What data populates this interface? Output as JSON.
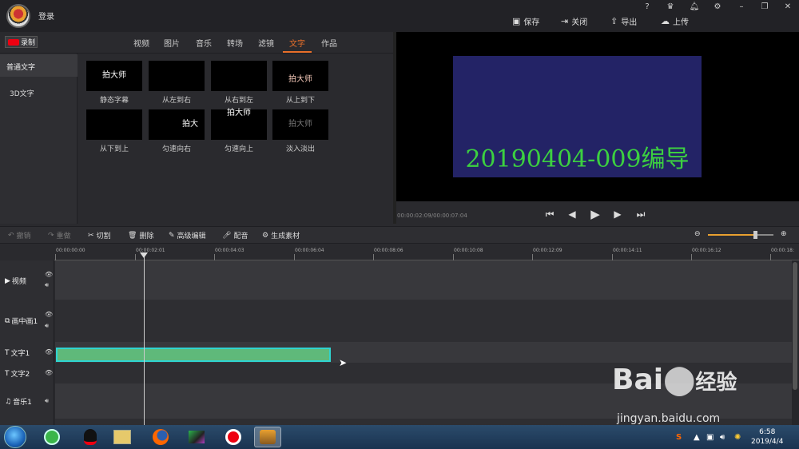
{
  "header": {
    "login": "登录",
    "actions": [
      {
        "label": "保存",
        "icon": "save-icon"
      },
      {
        "label": "关闭",
        "icon": "close-file-icon"
      },
      {
        "label": "导出",
        "icon": "export-icon"
      },
      {
        "label": "上传",
        "icon": "upload-icon"
      }
    ]
  },
  "record_label": "录制",
  "tabs": [
    "视频",
    "图片",
    "音乐",
    "转场",
    "滤镜",
    "文字",
    "作品"
  ],
  "active_tab": "文字",
  "categories": [
    "普通文字",
    "3D文字"
  ],
  "thumbnails": [
    {
      "label": "静态字幕",
      "preview": "拍大师"
    },
    {
      "label": "从左到右",
      "preview": ""
    },
    {
      "label": "从右到左",
      "preview": ""
    },
    {
      "label": "从上到下",
      "preview": "拍大师"
    },
    {
      "label": "从下到上",
      "preview": ""
    },
    {
      "label": "匀速向右",
      "preview": "拍大"
    },
    {
      "label": "匀速向上",
      "preview": "拍大师"
    },
    {
      "label": "淡入淡出",
      "preview": "拍大师"
    }
  ],
  "preview": {
    "overlay_text": "20190404-009编导",
    "timecode": "00:00:02:09/00:00:07:04"
  },
  "toolbar": {
    "undo": "撤销",
    "redo": "重做",
    "cut": "切割",
    "delete": "删除",
    "advanced_edit": "高级编辑",
    "dub": "配音",
    "generate": "生成素材"
  },
  "ruler_ticks": [
    "00:00:00:00",
    "00:00:02:01",
    "00:00:04:03",
    "00:00:06:04",
    "00:00:08:06",
    "00:00:10:08",
    "00:00:12:09",
    "00:00:14:11",
    "00:00:16:12",
    "00:00:18:"
  ],
  "tracks": [
    {
      "label": "视频",
      "icon": "video-track-icon"
    },
    {
      "label": "画中画1",
      "icon": "pip-track-icon"
    },
    {
      "label": "文字1",
      "icon": "text-track-icon"
    },
    {
      "label": "文字2",
      "icon": "text-track-icon"
    },
    {
      "label": "音乐1",
      "icon": "music-track-icon"
    }
  ],
  "watermark": {
    "brand": "Bai",
    "brand2": "经验",
    "url": "jingyan.baidu.com"
  },
  "taskbar": {
    "time": "6:58",
    "date": "2019/4/4"
  }
}
